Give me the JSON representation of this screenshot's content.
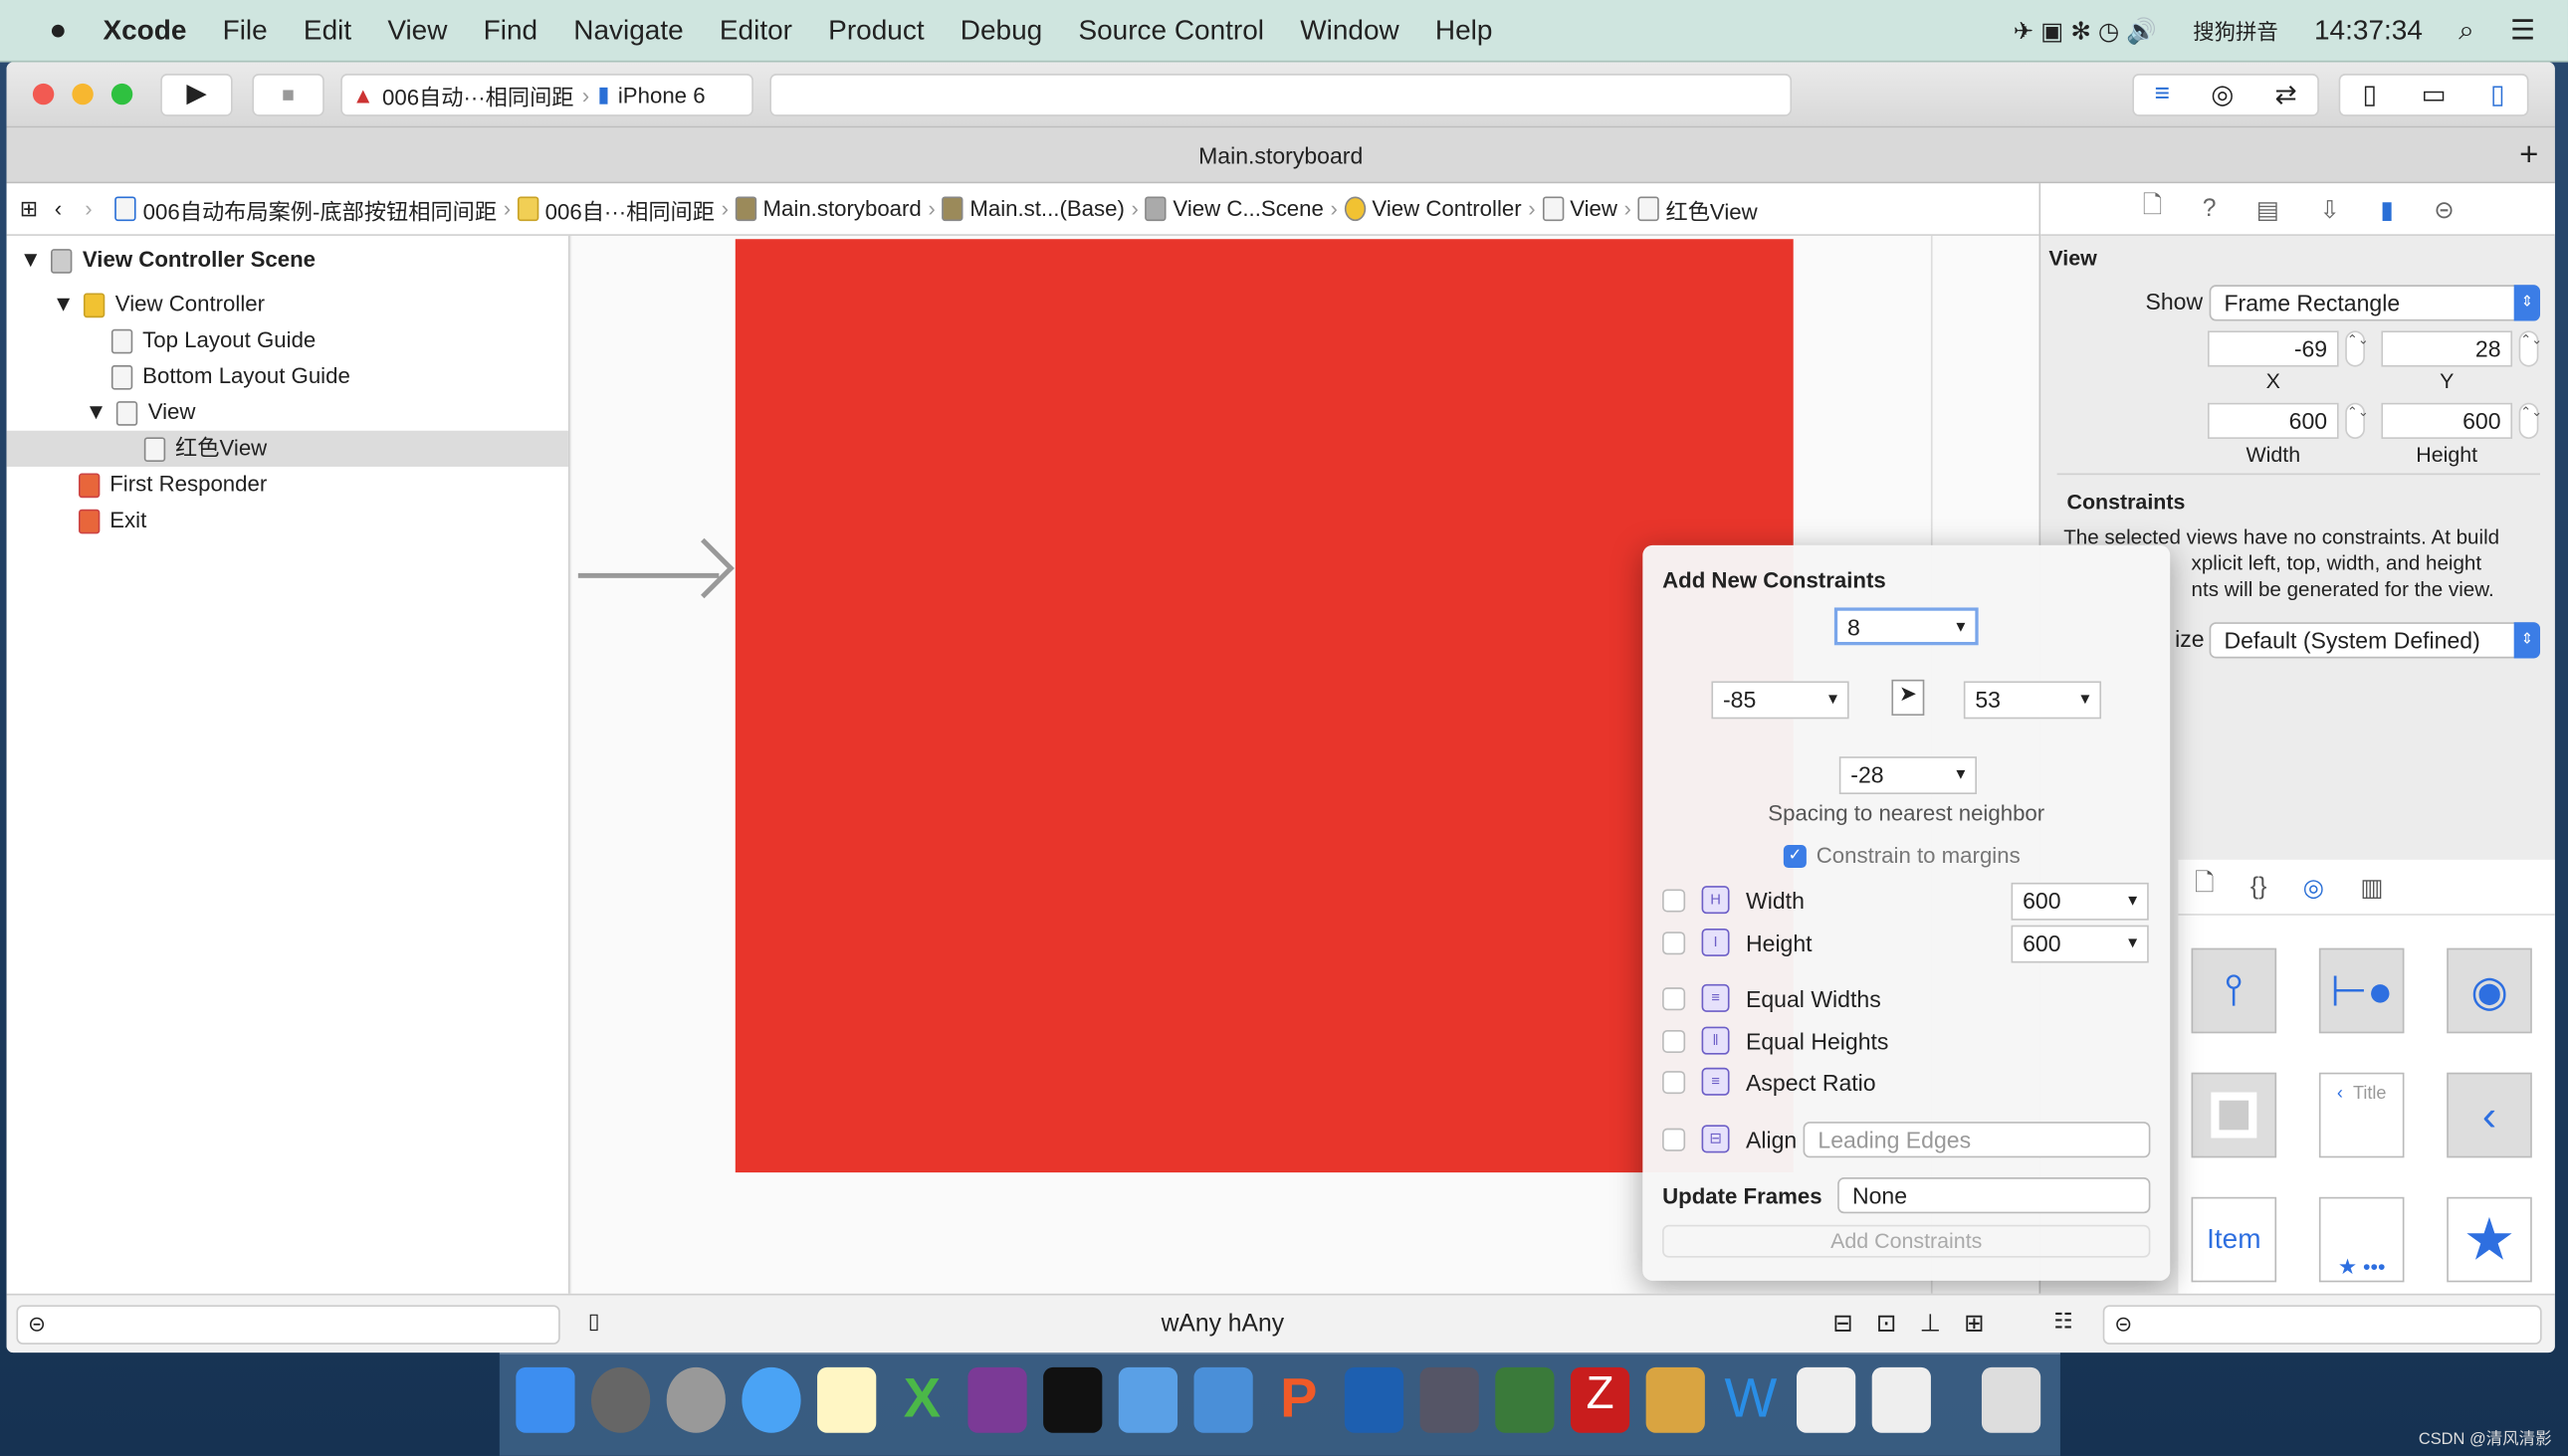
{
  "menubar": {
    "app": "Xcode",
    "items": [
      "File",
      "Edit",
      "View",
      "Find",
      "Navigate",
      "Editor",
      "Product",
      "Debug",
      "Source Control",
      "Window",
      "Help"
    ],
    "input_method": "搜狗拼音",
    "clock": "14:37:34"
  },
  "toolbar": {
    "scheme": "006自动···相同间距",
    "device": "iPhone 6"
  },
  "tab": {
    "title": "Main.storyboard"
  },
  "jumpbar": [
    "006自动布局案例-底部按钮相同间距",
    "006自···相同间距",
    "Main.storyboard",
    "Main.st...(Base)",
    "View C...Scene",
    "View Controller",
    "View",
    "红色View"
  ],
  "outline": {
    "scene": "View Controller Scene",
    "vc": "View Controller",
    "top": "Top Layout Guide",
    "bottom": "Bottom Layout Guide",
    "view": "View",
    "red": "红色View",
    "responder": "First Responder",
    "exit": "Exit"
  },
  "inspector": {
    "section": "View",
    "show_label": "Show",
    "show_value": "Frame Rectangle",
    "x": "-69",
    "y": "28",
    "width": "600",
    "height": "600",
    "x_label": "X",
    "y_label": "Y",
    "w_label": "Width",
    "h_label": "Height",
    "constraints_title": "Constraints",
    "constraints_text_1": "The selected views have no constraints. At build",
    "constraints_text_2": "xplicit left, top, width, and height",
    "constraints_text_3": "nts will be generated for the view.",
    "size_label": "ize",
    "size_value": "Default (System Defined)"
  },
  "popover": {
    "title": "Add New Constraints",
    "top": "8",
    "left": "-85",
    "right": "53",
    "bottom": "-28",
    "spacing_label": "Spacing to nearest neighbor",
    "margins_label": "Constrain to margins",
    "margins_checked": true,
    "width_label": "Width",
    "width_value": "600",
    "height_label": "Height",
    "height_value": "600",
    "equal_widths": "Equal Widths",
    "equal_heights": "Equal Heights",
    "aspect_ratio": "Aspect Ratio",
    "align_label": "Align",
    "align_value": "Leading Edges",
    "update_frames_label": "Update Frames",
    "update_frames_value": "None",
    "add_button": "Add Constraints"
  },
  "library": {
    "title_tile": "Title",
    "item_tile": "Item"
  },
  "canvas": {
    "size_class": "wAny hAny",
    "red_color": "#e8352b"
  },
  "watermark": "CSDN @清风清影"
}
